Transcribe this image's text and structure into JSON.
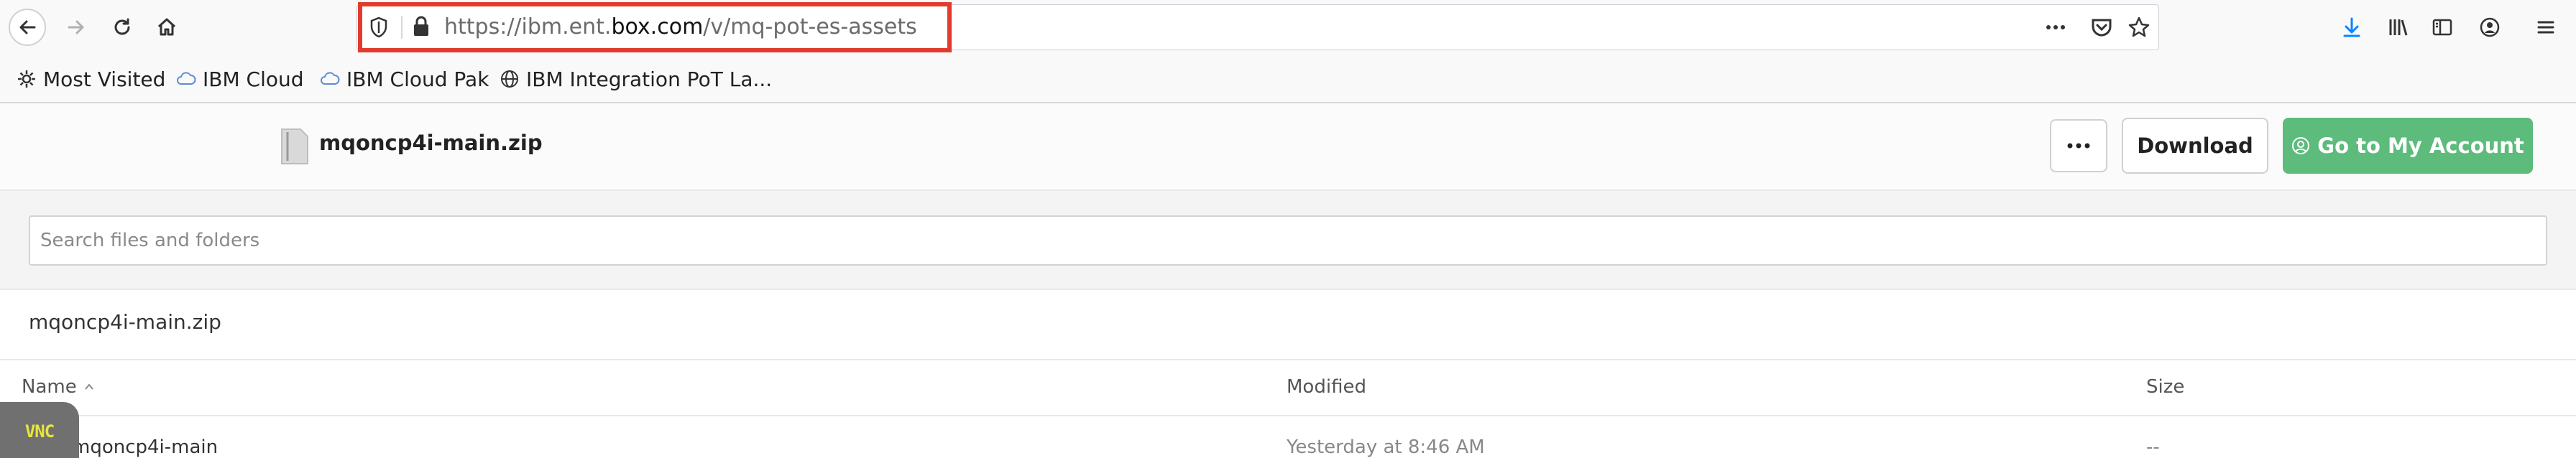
{
  "browser": {
    "url_prefix": "https://ibm.ent.",
    "url_domain": "box.com",
    "url_path": "/v/mq-pot-es-assets",
    "bookmarks": [
      {
        "label": "Most Visited",
        "icon": "gear-icon"
      },
      {
        "label": "IBM Cloud",
        "icon": "cloud-icon"
      },
      {
        "label": "IBM Cloud Pak",
        "icon": "cloud-icon"
      },
      {
        "label": "IBM Integration PoT La...",
        "icon": "globe-icon"
      }
    ],
    "highlight_color": "#e23b2e"
  },
  "header": {
    "file_name": "mqoncp4i-main.zip",
    "download_label": "Download",
    "account_label": "Go to My Account",
    "accent_color": "#5dbb7c"
  },
  "search": {
    "placeholder": "Search files and folders"
  },
  "breadcrumb": "mqoncp4i-main.zip",
  "table": {
    "columns": {
      "name": "Name",
      "modified": "Modified",
      "size": "Size"
    },
    "rows": [
      {
        "name": "mqoncp4i-main",
        "modified": "Yesterday at 8:46 AM",
        "size": "--"
      }
    ]
  },
  "overlay": {
    "vnc_label": "VNC"
  }
}
